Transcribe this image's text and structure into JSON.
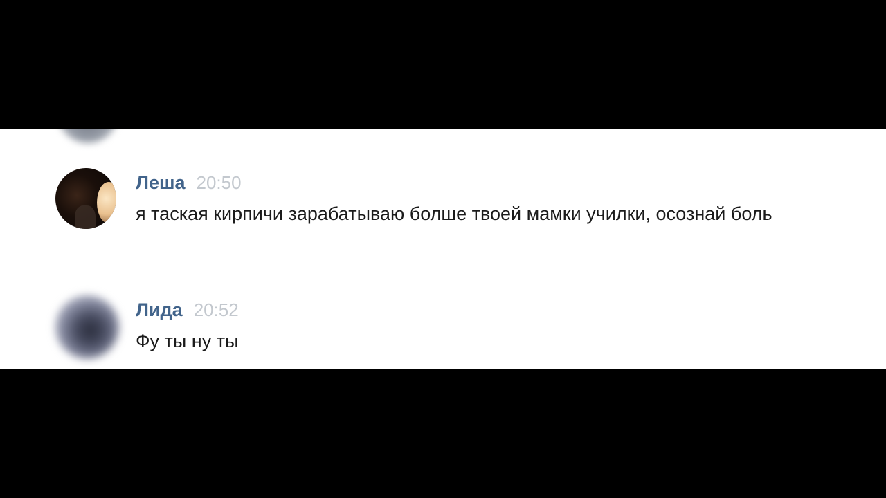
{
  "messages": [
    {
      "author": "Леша",
      "time": "20:50",
      "text": "я таская кирпичи зарабатываю болше твоей мамки училки, осознай боль",
      "avatar": "blurred-photo-avatar"
    },
    {
      "author": "Лида",
      "time": "20:52",
      "text": "Фу ты ну ты",
      "avatar": "blurred-photo-avatar"
    }
  ],
  "colors": {
    "background_bars": "#000000",
    "chat_background": "#ffffff",
    "author_name": "#42648b",
    "timestamp": "#c3c8ce",
    "message_text": "#1b1b1b"
  }
}
